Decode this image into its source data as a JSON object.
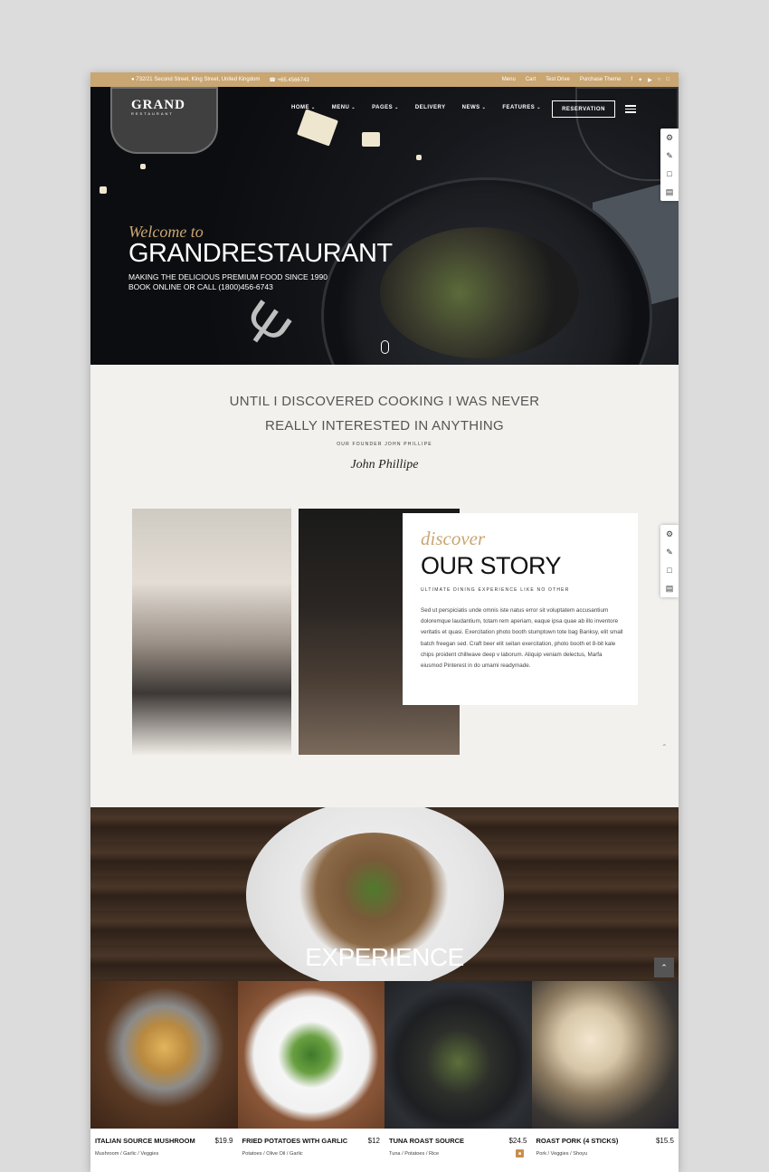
{
  "topbar": {
    "address": "732/21 Second Street, King Street, United Kingdom",
    "phone": "+65.4566743",
    "links": [
      "Menu",
      "Cart",
      "Test Drive",
      "Purchase Theme"
    ]
  },
  "logo": {
    "title": "GRAND",
    "subtitle": "RESTAURANT"
  },
  "nav": {
    "items": [
      {
        "label": "HOME",
        "has_dropdown": true
      },
      {
        "label": "MENU",
        "has_dropdown": true
      },
      {
        "label": "PAGES",
        "has_dropdown": true
      },
      {
        "label": "DELIVERY",
        "has_dropdown": false
      },
      {
        "label": "NEWS",
        "has_dropdown": true
      },
      {
        "label": "FEATURES",
        "has_dropdown": true
      }
    ],
    "reservation_label": "RESERVATION"
  },
  "hero": {
    "welcome": "Welcome to",
    "title": "GRANDRESTAURANT",
    "sub_line1": "MAKING THE DELICIOUS PREMIUM FOOD SINCE 1990",
    "sub_line2": "BOOK ONLINE OR CALL (1800)456-6743"
  },
  "side_tools": [
    "gear-icon",
    "edit-icon",
    "book-icon",
    "basket-icon"
  ],
  "quote": {
    "line1": "UNTIL I DISCOVERED COOKING I WAS NEVER",
    "line2": "REALLY INTERESTED IN ANYTHING",
    "by": "OUR FOUNDER JOHN PHILLIPE",
    "signature": "John Phillipe"
  },
  "story": {
    "script": "discover",
    "title": "OUR STORY",
    "kicker": "ULTIMATE DINING EXPERIENCE LIKE NO OTHER",
    "body": "Sed ut perspiciatis unde omnis iste natus error sit voluptatem accusantium doloremque laudantium, totam rem aperiam, eaque ipsa quae ab illo inventore veritatis et quasi. Exercitation photo booth stumptown tote bag Banksy, elit small batch freegan sed. Craft beer elit seitan exercitation, photo booth et 8-bit kale chips proident chillwave deep v laborum. Aliquip veniam delectus, Marfa eiusmod Pinterest in do umami readymade."
  },
  "experience": {
    "word": "EXPERIENCE"
  },
  "menu_items": [
    {
      "name": "ITALIAN SOURCE MUSHROOM",
      "price": "$19.9",
      "ingredients": "Mushroom / Garlic / Veggies"
    },
    {
      "name": "FRIED POTATOES WITH GARLIC",
      "price": "$12",
      "ingredients": "Potatoes / Olive Oil / Garlic"
    },
    {
      "name": "TUNA ROAST SOURCE",
      "price": "$24.5",
      "ingredients": "Tuna / Potatoes / Rice"
    },
    {
      "name": "ROAST PORK (4 STICKS)",
      "price": "$15.5",
      "ingredients": "Pork / Veggies / Shoyu"
    }
  ]
}
